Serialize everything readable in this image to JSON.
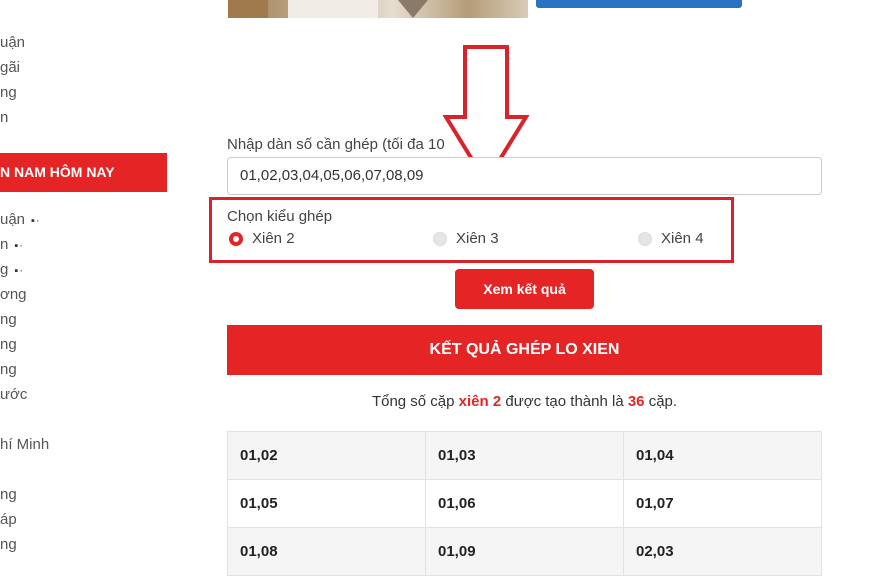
{
  "sidebar": {
    "items_top": [
      "uận",
      "gãi",
      "ng",
      "n"
    ],
    "header": "N NAM HÔM NAY",
    "items": [
      {
        "label": "uận",
        "dots": "▪·"
      },
      {
        "label": "n",
        "dots": "▪·"
      },
      {
        "label": "g",
        "dots": "▪·"
      },
      {
        "label": "ơng",
        "dots": ""
      },
      {
        "label": "ng",
        "dots": ""
      },
      {
        "label": "ng",
        "dots": ""
      },
      {
        "label": "ng",
        "dots": ""
      },
      {
        "label": "ước",
        "dots": ""
      },
      {
        "label": "hí Minh",
        "dots": ""
      },
      {
        "label": "ng",
        "dots": ""
      },
      {
        "label": "áp",
        "dots": ""
      },
      {
        "label": "ng",
        "dots": ""
      }
    ]
  },
  "form": {
    "input_label": "Nhập dàn số cần ghép (tối đa 10",
    "input_value": "01,02,03,04,05,06,07,08,09",
    "mode_label": "Chọn kiểu ghép",
    "options": [
      {
        "label": "Xiên 2",
        "checked": true
      },
      {
        "label": "Xiên 3",
        "checked": false
      },
      {
        "label": "Xiên 4",
        "checked": false
      }
    ],
    "submit_label": "Xem kết quả"
  },
  "result": {
    "header": "KẾT QUẢ GHÉP LO XIEN",
    "summary_prefix": "Tổng số cặp",
    "summary_type": "xiên 2",
    "summary_middle": "được tạo thành là",
    "summary_count": "36",
    "summary_suffix": "cặp.",
    "pairs": [
      [
        "01,02",
        "01,03",
        "01,04"
      ],
      [
        "01,05",
        "01,06",
        "01,07"
      ],
      [
        "01,08",
        "01,09",
        "02,03"
      ]
    ]
  },
  "colors": {
    "accent": "#e52525",
    "annotation": "#d8232a",
    "top_button": "#2a73c2"
  }
}
